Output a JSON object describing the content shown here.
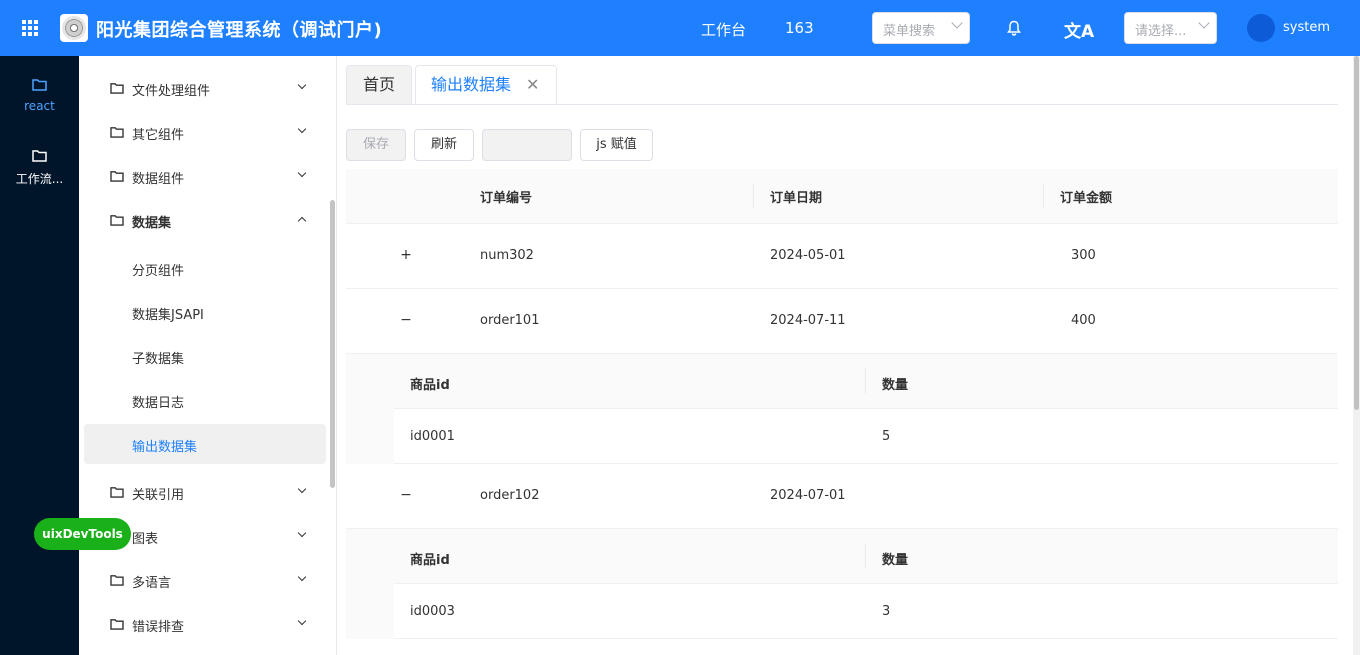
{
  "header": {
    "title": "阳光集团综合管理系统（调试门户)",
    "workbench": "工作台",
    "count": "163",
    "menu_search_placeholder": "菜单搜索",
    "select_placeholder": "请选择...",
    "user": "system",
    "translate_glyph": "文A",
    "bg_color": "#1e80ff"
  },
  "rail": {
    "items": [
      {
        "label": "react",
        "icon": "folder-icon",
        "active": true
      },
      {
        "label": "工作流...",
        "icon": "folder-icon",
        "active": false
      }
    ]
  },
  "menu": {
    "groups": [
      {
        "label": "文件处理组件",
        "expanded": false
      },
      {
        "label": "其它组件",
        "expanded": false
      },
      {
        "label": "数据组件",
        "expanded": false
      },
      {
        "label": "数据集",
        "expanded": true
      },
      {
        "label": "关联引用",
        "expanded": false
      },
      {
        "label": "图表",
        "expanded": false
      },
      {
        "label": "多语言",
        "expanded": false
      },
      {
        "label": "错误排查",
        "expanded": false
      }
    ],
    "sub_items": [
      {
        "label": "分页组件"
      },
      {
        "label": "数据集JSAPI"
      },
      {
        "label": "子数据集"
      },
      {
        "label": "数据日志"
      },
      {
        "label": "输出数据集",
        "active": true
      }
    ]
  },
  "devtools": "uixDevTools",
  "tabs": [
    {
      "label": "首页"
    },
    {
      "label": "输出数据集",
      "active": true,
      "close": "✕"
    }
  ],
  "toolbar": {
    "save": "保存",
    "refresh": "刷新",
    "blank": "",
    "js_assign": "js 赋值"
  },
  "table": {
    "columns": [
      "订单编号",
      "订单日期",
      "订单金额"
    ],
    "rows": [
      {
        "expander": "+",
        "id": "num302",
        "date": "2024-05-01",
        "amount": "300",
        "expanded": false
      },
      {
        "expander": "−",
        "id": "order101",
        "date": "2024-07-11",
        "amount": "400",
        "expanded": true,
        "children": {
          "columns": [
            "商品id",
            "数量"
          ],
          "rows": [
            {
              "id": "id0001",
              "qty": "5"
            }
          ]
        }
      },
      {
        "expander": "−",
        "id": "order102",
        "date": "2024-07-01",
        "amount": "",
        "expanded": true,
        "children": {
          "columns": [
            "商品id",
            "数量"
          ],
          "rows": [
            {
              "id": "id0003",
              "qty": "3"
            }
          ]
        }
      }
    ]
  }
}
